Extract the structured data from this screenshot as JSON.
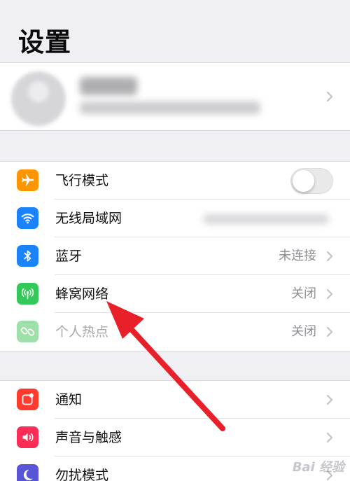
{
  "header": {
    "title": "设置"
  },
  "group1": [
    {
      "label": "飞行模式",
      "icon": "airplane-icon",
      "color": "#ff9500",
      "accessory": "toggle",
      "toggle_on": false
    },
    {
      "label": "无线局域网",
      "icon": "wifi-icon",
      "color": "#1a82fb",
      "accessory": "chevron",
      "value": ""
    },
    {
      "label": "蓝牙",
      "icon": "bluetooth-icon",
      "color": "#1a82fb",
      "accessory": "chevron",
      "value": "未连接"
    },
    {
      "label": "蜂窝网络",
      "icon": "cellular-icon",
      "color": "#34c759",
      "accessory": "chevron",
      "value": "关闭"
    },
    {
      "label": "个人热点",
      "icon": "hotspot-icon",
      "color": "#9fdfa9",
      "accessory": "chevron",
      "value": "关闭",
      "disabled": true
    }
  ],
  "group2": [
    {
      "label": "通知",
      "icon": "notifications-icon",
      "color": "#ff3b30",
      "accessory": "chevron"
    },
    {
      "label": "声音与触感",
      "icon": "sound-icon",
      "color": "#ff2d55",
      "accessory": "chevron"
    },
    {
      "label": "勿扰模式",
      "icon": "moon-icon",
      "color": "#5856d6",
      "accessory": "chevron"
    }
  ],
  "watermark": "Bai 经验",
  "annotation": {
    "type": "red-arrow",
    "color": "#e8202a",
    "points_to": "蜂窝网络"
  }
}
